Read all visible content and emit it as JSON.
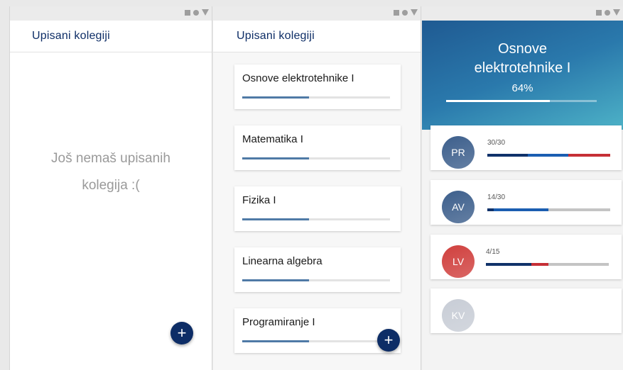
{
  "screen1": {
    "title": "Upisani kolegiji",
    "empty_line1": "Još nemaš upisanih",
    "empty_line2": "kolegija :(",
    "fab_label": "+"
  },
  "screen2": {
    "title": "Upisani kolegiji",
    "fab_label": "+",
    "courses": [
      {
        "name": "Osnove elektrotehnike I",
        "progress": 0.45
      },
      {
        "name": "Matematika I",
        "progress": 0.45
      },
      {
        "name": "Fizika I",
        "progress": 0.45
      },
      {
        "name": "Linearna algebra",
        "progress": 0.45
      },
      {
        "name": "Programiranje I",
        "progress": 0.45
      }
    ]
  },
  "screen3": {
    "course_title_line1": "Osnove",
    "course_title_line2": "elektrotehnike I",
    "percent": "64%",
    "progress": 0.69,
    "categories": [
      {
        "abbr": "PR",
        "score": "30/30",
        "avatar_color": "#3d5f8c",
        "segments": [
          {
            "fraction": 0.33,
            "color": "#10326a"
          },
          {
            "fraction": 0.33,
            "color": "#1b5eb1"
          },
          {
            "fraction": 0.34,
            "color": "#c62f36"
          }
        ]
      },
      {
        "abbr": "AV",
        "score": "14/30",
        "avatar_color": "#3d5f8c",
        "segments": [
          {
            "fraction": 0.05,
            "color": "#10326a"
          },
          {
            "fraction": 0.45,
            "color": "#1b5eb1"
          }
        ]
      },
      {
        "abbr": "LV",
        "score": "4/15",
        "avatar_color": "#d0403e",
        "segments": [
          {
            "fraction": 0.37,
            "color": "#10326a"
          },
          {
            "fraction": 0.14,
            "color": "#c62f36"
          }
        ]
      },
      {
        "abbr": "KV",
        "score": "",
        "avatar_color": "#c8cdd6",
        "segments": []
      }
    ]
  }
}
